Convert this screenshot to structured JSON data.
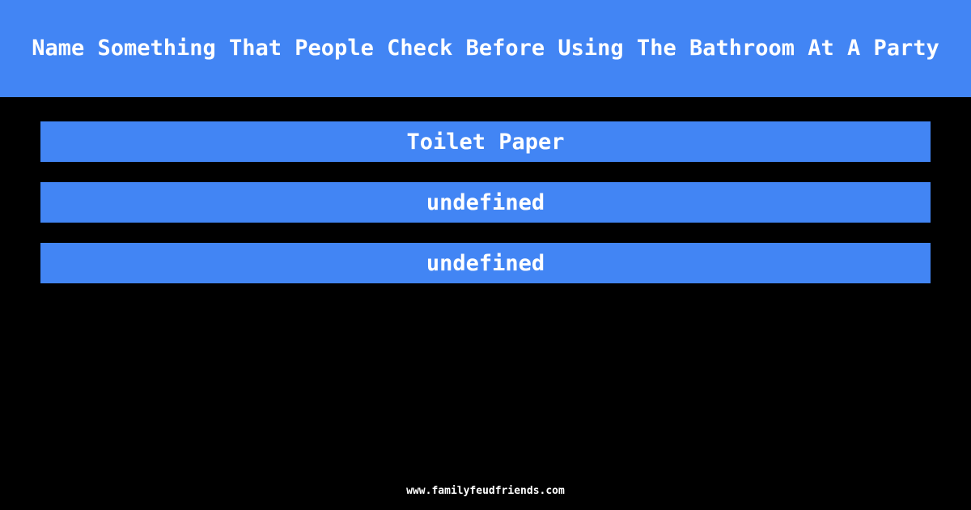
{
  "colors": {
    "background": "#000000",
    "accent": "#4285f4",
    "text_on_accent": "#ffffff",
    "footer_text": "#ffffff"
  },
  "header": {
    "question": "Name Something That People Check Before Using The Bathroom At A Party"
  },
  "answers": [
    {
      "text": "Toilet Paper"
    },
    {
      "text": "undefined"
    },
    {
      "text": "undefined"
    }
  ],
  "footer": {
    "site_url": "www.familyfeudfriends.com"
  }
}
